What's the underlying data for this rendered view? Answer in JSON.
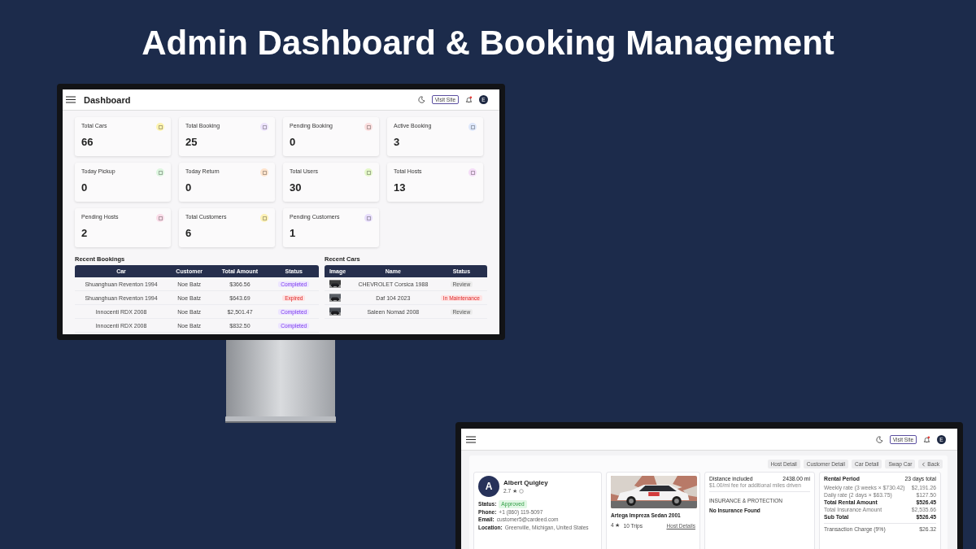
{
  "headline": "Admin Dashboard & Booking Management",
  "dashboard": {
    "title": "Dashboard",
    "visit_site": "Visit Site",
    "avatar": "E",
    "stats": [
      {
        "label": "Total Cars",
        "value": "66",
        "color": "#fdf3b0"
      },
      {
        "label": "Total Booking",
        "value": "25",
        "color": "#ece2fb"
      },
      {
        "label": "Pending Booking",
        "value": "0",
        "color": "#fbdede"
      },
      {
        "label": "Active Booking",
        "value": "3",
        "color": "#dde7fb"
      },
      {
        "label": "Today Pickup",
        "value": "0",
        "color": "#dcf5de"
      },
      {
        "label": "Today Return",
        "value": "0",
        "color": "#fde3cc"
      },
      {
        "label": "Total Users",
        "value": "30",
        "color": "#e3f7c8"
      },
      {
        "label": "Total Hosts",
        "value": "13",
        "color": "#f4dcf7"
      },
      {
        "label": "Pending Hosts",
        "value": "2",
        "color": "#fadce8"
      },
      {
        "label": "Total Customers",
        "value": "6",
        "color": "#fdf1b5"
      },
      {
        "label": "Pending Customers",
        "value": "1",
        "color": "#e7ddfb"
      }
    ],
    "recent_bookings": {
      "title": "Recent Bookings",
      "columns": [
        "Car",
        "Customer",
        "Total Amount",
        "Status"
      ],
      "rows": [
        {
          "car": "Shuanghuan Reventon 1994",
          "customer": "Noe Batz",
          "amount": "$366.56",
          "status": {
            "label": "Completed",
            "kind": "completed"
          }
        },
        {
          "car": "Shuanghuan Reventon 1994",
          "customer": "Noe Batz",
          "amount": "$643.69",
          "status": {
            "label": "Expired",
            "kind": "expired"
          }
        },
        {
          "car": "Innocenti RDX 2008",
          "customer": "Noe Batz",
          "amount": "$2,501.47",
          "status": {
            "label": "Completed",
            "kind": "completed"
          }
        },
        {
          "car": "Innocenti RDX 2008",
          "customer": "Noe Batz",
          "amount": "$832.50",
          "status": {
            "label": "Completed",
            "kind": "completed"
          }
        }
      ]
    },
    "recent_cars": {
      "title": "Recent Cars",
      "columns": [
        "Image",
        "Name",
        "Status"
      ],
      "rows": [
        {
          "name": "CHEVROLET Corsica 1988",
          "status": {
            "label": "Review",
            "kind": "review"
          }
        },
        {
          "name": "Daf 104 2023",
          "status": {
            "label": "In Maintenance",
            "kind": "maintenance"
          }
        },
        {
          "name": "Saleen Nomad 2008",
          "status": {
            "label": "Review",
            "kind": "review"
          }
        }
      ]
    }
  },
  "booking_detail": {
    "visit_site": "Visit Site",
    "avatar": "E",
    "actions": [
      "Host Detail",
      "Customer Detail",
      "Car Detail",
      "Swap Car"
    ],
    "back": "Back",
    "customer": {
      "initial": "A",
      "name": "Albert Quigley",
      "rating": "2.7 ★",
      "fields": [
        {
          "label": "Status:",
          "value": "Approved",
          "kind": "badge"
        },
        {
          "label": "Phone:",
          "value": "+1 (860) 119-5097",
          "kind": "text"
        },
        {
          "label": "Email:",
          "value": "customer5@cardeed.com",
          "kind": "text"
        },
        {
          "label": "Location:",
          "value": "Greenville, Michigan, United States",
          "kind": "text"
        }
      ]
    },
    "car": {
      "name": "Artega Impreza Sedan 2001",
      "rating": "4 ★",
      "trips": "10 Trips",
      "link": "Host Details"
    },
    "distance": {
      "label": "Distance included",
      "value": "2438.00 mi",
      "note": "$1.00/mi fee for additional miles driven"
    },
    "insurance": {
      "heading": "INSURANCE & PROTECTION",
      "text": "No Insurance Found"
    },
    "rental": {
      "title": "Rental Period",
      "total": "23 days total",
      "lines": [
        {
          "label": "Weekly rate (3 weeks × $730.42)",
          "value": "$2,191.26",
          "bold": false
        },
        {
          "label": "Daily rate (2 days × $63.75)",
          "value": "$127.50",
          "bold": false
        },
        {
          "label": "Total Rental Amount",
          "value": "$526.45",
          "bold": true
        },
        {
          "label": "Total Insurance Amount",
          "value": "$2,535.66",
          "bold": false
        },
        {
          "label": "Sub Total",
          "value": "$526.45",
          "bold": true
        }
      ],
      "charge": {
        "label": "Transaction Charge (9%)",
        "value": "$26.32"
      }
    }
  }
}
